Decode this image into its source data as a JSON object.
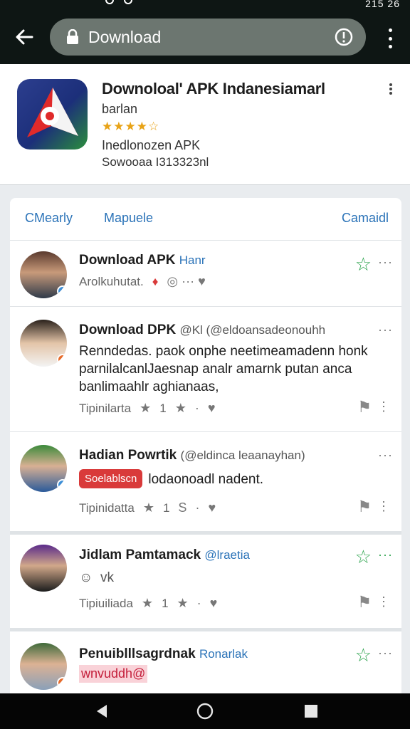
{
  "status": {
    "time": "215 26"
  },
  "browser": {
    "url": "Download",
    "back_icon": "arrow-left-icon",
    "menu_icon": "more-vertical-icon"
  },
  "app": {
    "title": "Downoloаl' APK Indanesiamarl",
    "subtitle": "barlan",
    "rating_stars": "★★★★☆",
    "rating": 4,
    "line3": "Inedlonozen APK",
    "line4": "Sowooaa I313323nl"
  },
  "tabs": {
    "left": "CΜearly",
    "middle": "Mapuele",
    "right": "Camaidl"
  },
  "posts": [
    {
      "name": "Download APK",
      "handle": "Hanr",
      "body": "",
      "meta_text": "Arolkuhutat.",
      "meta_extra": "◎ ··· ♥"
    },
    {
      "name": "Download DPK",
      "handle": "@Kl (@eldoansadeonouhh",
      "body": "Renndedas. paok onphe neetimeamadenn honk parnilalcanlJaesnap analr amarnk putan anca banlimaahlr aghianaas,",
      "meta_text": "Tipinilarta",
      "meta_count": "1"
    },
    {
      "name": "Hadian Powrtik",
      "handle": "(@eldinca leaanayhan)",
      "tag": "Soelablscn",
      "body": "lodaonoadl nadent.",
      "meta_text": "Tipinidatta",
      "meta_count": "1"
    },
    {
      "name": "Jidlam Pamtamack",
      "handle": "@lraetia",
      "body": "☺  vk",
      "meta_text": "Tipiuiliada",
      "meta_count": "1"
    },
    {
      "name": "Penuiblllsagrdnak",
      "handle": "Ronarlak",
      "body": "wnvuddh@"
    }
  ],
  "colors": {
    "accent_blue": "#2b73b8",
    "star_green": "#2da44e",
    "rating": "#e8a317"
  }
}
